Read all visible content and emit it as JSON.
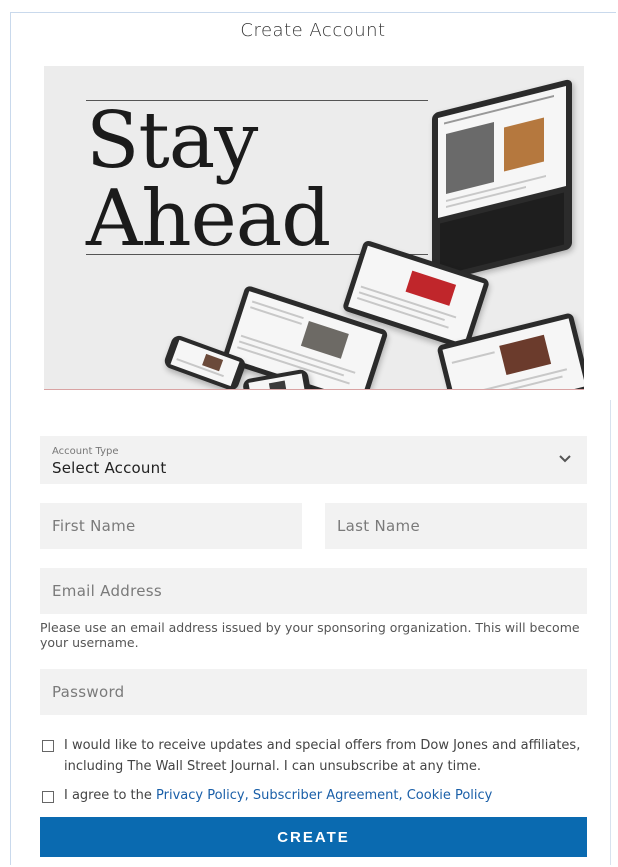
{
  "page": {
    "title": "Create Account"
  },
  "hero": {
    "line1": "Stay",
    "line2": "Ahead"
  },
  "form": {
    "account_type": {
      "label": "Account Type",
      "value": "Select Account"
    },
    "first_name": {
      "placeholder": "First Name"
    },
    "last_name": {
      "placeholder": "Last Name"
    },
    "email": {
      "placeholder": "Email Address"
    },
    "email_hint": "Please use an email address issued by your sponsoring organization. This will become your username.",
    "password": {
      "placeholder": "Password"
    },
    "updates_consent": "I would like to receive updates and special offers from Dow Jones and affiliates, including The Wall Street Journal. I can unsubscribe at any time.",
    "agree": {
      "prefix": "I agree to the ",
      "privacy_policy": "Privacy Policy",
      "sep1": ", ",
      "subscriber_agreement": "Subscriber Agreement",
      "sep2": ", ",
      "cookie_policy": "Cookie Policy"
    },
    "submit_label": "CREATE"
  },
  "icons": {
    "dropdown": "chevron-down-icon",
    "checkbox": "checkbox-icon"
  },
  "colors": {
    "accent": "#0a6ab0",
    "link": "#1a5fa8",
    "field_bg": "#f2f2f2"
  }
}
